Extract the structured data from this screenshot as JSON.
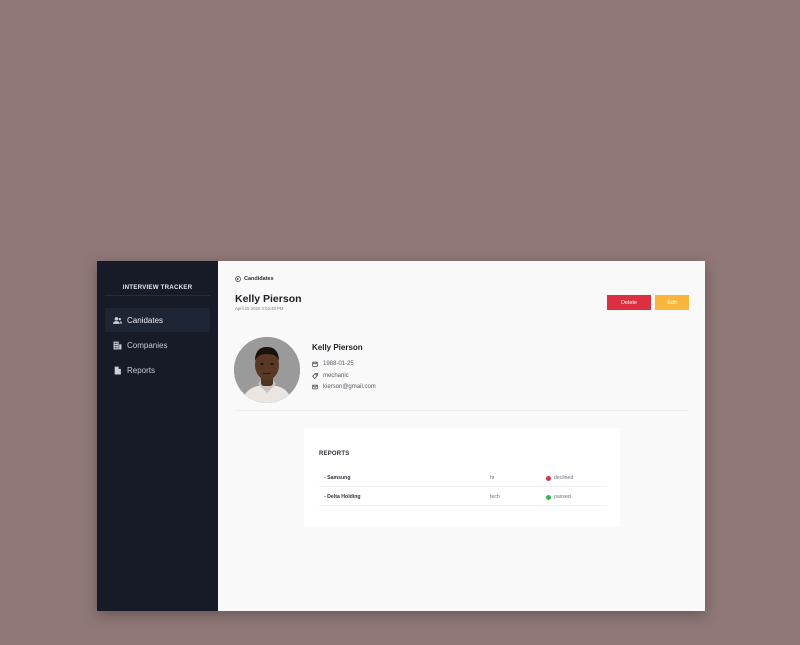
{
  "sidebar": {
    "brand": "INTERVIEW TRACKER",
    "items": [
      {
        "label": "Canidates",
        "icon": "users-icon",
        "active": true
      },
      {
        "label": "Companies",
        "icon": "building-icon",
        "active": false
      },
      {
        "label": "Reports",
        "icon": "document-icon",
        "active": false
      }
    ]
  },
  "header": {
    "back_label": "Candidates",
    "title": "Kelly Pierson",
    "subtitle": "April 15 2020 4:03:48 PM",
    "delete_label": "Delete",
    "edit_label": "Edit"
  },
  "profile": {
    "name": "Kelly Pierson",
    "birthdate": "1988-01-25",
    "position": "mechanic",
    "email": "kierson@gmail.com"
  },
  "reports": {
    "title": "REPORTS",
    "rows": [
      {
        "company": "- Samsung",
        "stage": "hr",
        "status": "declined",
        "status_color": "#d9333f"
      },
      {
        "company": "- Delta Holding",
        "stage": "tech",
        "status": "passed",
        "status_color": "#2fb84a"
      }
    ]
  },
  "colors": {
    "background": "#8f7877",
    "sidebar": "#161b27",
    "delete": "#dc3040",
    "edit": "#f9b43a"
  }
}
